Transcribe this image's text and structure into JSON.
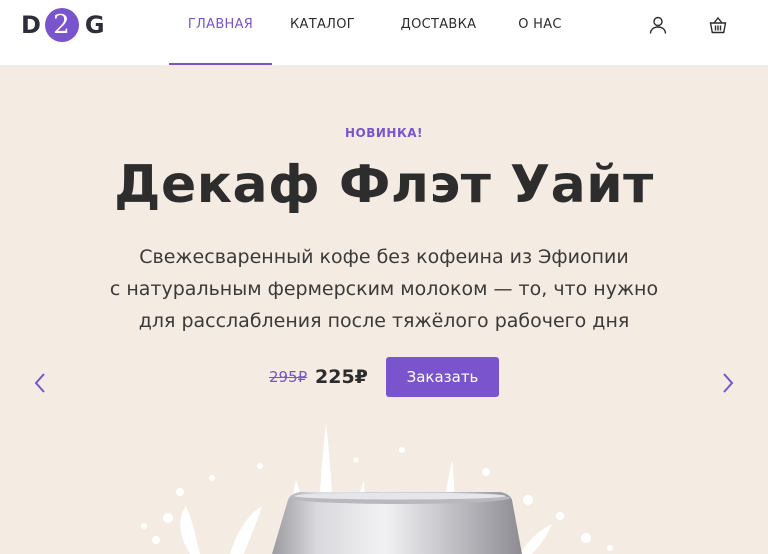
{
  "logo": {
    "letter_left": "D",
    "letter_middle": "2",
    "letter_right": "G"
  },
  "nav": {
    "items": [
      {
        "label": "ГЛАВНАЯ",
        "active": true
      },
      {
        "label": "КАТАЛОГ",
        "active": false
      },
      {
        "label": "ДОСТАВКА",
        "active": false
      },
      {
        "label": "О НАС",
        "active": false
      }
    ]
  },
  "header_icons": {
    "account": "user-icon",
    "cart": "basket-icon"
  },
  "hero": {
    "badge": "НОВИНКА!",
    "title": "Декаф Флэт Уайт",
    "description_lines": [
      "Свежесваренный кофе без кофеина из Эфиопии",
      "с натуральным фермерским молоком — то, что нужно",
      "для расслабления после тяжёлого рабочего дня"
    ],
    "old_price": "295₽",
    "new_price": "225₽",
    "order_label": "Заказать",
    "prev_icon": "chevron-left-icon",
    "next_icon": "chevron-right-icon"
  },
  "colors": {
    "accent": "#7a54cc",
    "hero_bg": "#f4ebe2",
    "header_bg": "#ffffff",
    "text": "#2c2c2c"
  }
}
